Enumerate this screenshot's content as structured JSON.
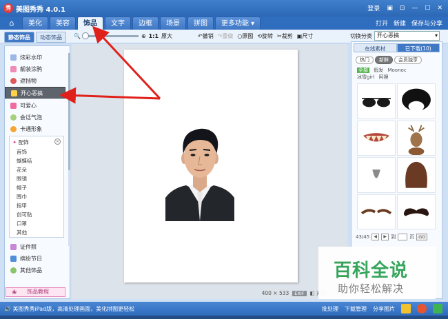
{
  "app": {
    "title": "美图秀秀 4.0.1",
    "logo_text": "秀"
  },
  "titlebar": {
    "login": "登录",
    "chat": "▣",
    "skin": "⊡",
    "minimize": "—",
    "maximize": "☐",
    "close": "✕"
  },
  "menubar": {
    "home_icon": "⌂",
    "tabs": [
      {
        "label": "美化"
      },
      {
        "label": "美容"
      },
      {
        "label": "饰品"
      },
      {
        "label": "文字"
      },
      {
        "label": "边框"
      },
      {
        "label": "场景"
      },
      {
        "label": "拼图"
      },
      {
        "label": "更多功能 ▾"
      }
    ],
    "open": "打开",
    "new": "新建",
    "save_share": "保存与分享"
  },
  "toolbar": {
    "subtabs": [
      {
        "label": "静态饰品"
      },
      {
        "label": "动态饰品"
      }
    ],
    "zoom_icon": "🔍",
    "zoom_in": "⊕",
    "ratio": "1:1",
    "original_size": "原大",
    "undo": "撤销",
    "redo": "重做",
    "original": "原图",
    "rotate": "旋转",
    "crop": "裁剪",
    "resize": "尺寸",
    "category_label": "切换分类",
    "category_value": "开心恶搞"
  },
  "sidebar": {
    "items": [
      {
        "label": "炫彩水印",
        "color": "#9fb7e8"
      },
      {
        "label": "靓装涂鸦",
        "color": "#f08bb7"
      },
      {
        "label": "遮挡物",
        "color": "#e05a5a"
      },
      {
        "label": "开心恶搞",
        "color": "#ffd24a"
      },
      {
        "label": "可爱心",
        "color": "#f26ba0"
      },
      {
        "label": "会话气泡",
        "color": "#a6d07a"
      },
      {
        "label": "卡通形象",
        "color": "#f6a531"
      }
    ],
    "sub_head": "配饰",
    "sub_items": [
      "首饰",
      "蝴蝶结",
      "花朵",
      "眼镜",
      "帽子",
      "围巾",
      "指甲",
      "创可贴",
      "口罩",
      "其他"
    ],
    "bottom_items": [
      {
        "label": "证件照",
        "color": "#c886d9"
      },
      {
        "label": "缤纷节日",
        "color": "#4e8fd8"
      },
      {
        "label": "其他饰品",
        "color": "#8cc46a"
      }
    ],
    "tutorial": "饰品教程"
  },
  "canvas": {
    "size_text": "400 × 533",
    "exif": "EXIF",
    "compare": "对比"
  },
  "rightpanel": {
    "tabs": [
      {
        "label": "在线素材"
      },
      {
        "label": "已下载(10)"
      }
    ],
    "filters": [
      {
        "label": "热门"
      },
      {
        "label": "新鲜"
      },
      {
        "label": "会员独享"
      }
    ],
    "tags": [
      "全部",
      "假发",
      "Moonoc",
      "冰雪girl",
      "阿狸"
    ],
    "pager": {
      "text": "43/45",
      "prev": "◀",
      "next": "▶",
      "goto": "到",
      "page": "页",
      "go": "GO"
    }
  },
  "watermark": {
    "line1": "百科全说",
    "line2": "助你轻松解决"
  },
  "statusbar": {
    "message": "美图秀秀iPad版，高清处理画面，美化拼图更轻松",
    "batch": "批处理",
    "download": "下载管理",
    "share": "分享图片"
  }
}
